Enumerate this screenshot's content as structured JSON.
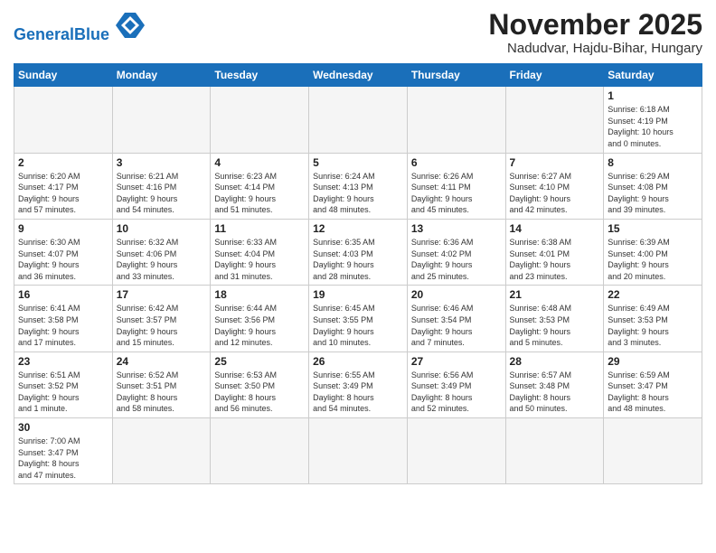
{
  "header": {
    "logo_general": "General",
    "logo_blue": "Blue",
    "title": "November 2025",
    "subtitle": "Nadudvar, Hajdu-Bihar, Hungary"
  },
  "weekdays": [
    "Sunday",
    "Monday",
    "Tuesday",
    "Wednesday",
    "Thursday",
    "Friday",
    "Saturday"
  ],
  "days": [
    {
      "num": "",
      "info": ""
    },
    {
      "num": "",
      "info": ""
    },
    {
      "num": "",
      "info": ""
    },
    {
      "num": "",
      "info": ""
    },
    {
      "num": "",
      "info": ""
    },
    {
      "num": "",
      "info": ""
    },
    {
      "num": "1",
      "info": "Sunrise: 6:18 AM\nSunset: 4:19 PM\nDaylight: 10 hours\nand 0 minutes."
    },
    {
      "num": "2",
      "info": "Sunrise: 6:20 AM\nSunset: 4:17 PM\nDaylight: 9 hours\nand 57 minutes."
    },
    {
      "num": "3",
      "info": "Sunrise: 6:21 AM\nSunset: 4:16 PM\nDaylight: 9 hours\nand 54 minutes."
    },
    {
      "num": "4",
      "info": "Sunrise: 6:23 AM\nSunset: 4:14 PM\nDaylight: 9 hours\nand 51 minutes."
    },
    {
      "num": "5",
      "info": "Sunrise: 6:24 AM\nSunset: 4:13 PM\nDaylight: 9 hours\nand 48 minutes."
    },
    {
      "num": "6",
      "info": "Sunrise: 6:26 AM\nSunset: 4:11 PM\nDaylight: 9 hours\nand 45 minutes."
    },
    {
      "num": "7",
      "info": "Sunrise: 6:27 AM\nSunset: 4:10 PM\nDaylight: 9 hours\nand 42 minutes."
    },
    {
      "num": "8",
      "info": "Sunrise: 6:29 AM\nSunset: 4:08 PM\nDaylight: 9 hours\nand 39 minutes."
    },
    {
      "num": "9",
      "info": "Sunrise: 6:30 AM\nSunset: 4:07 PM\nDaylight: 9 hours\nand 36 minutes."
    },
    {
      "num": "10",
      "info": "Sunrise: 6:32 AM\nSunset: 4:06 PM\nDaylight: 9 hours\nand 33 minutes."
    },
    {
      "num": "11",
      "info": "Sunrise: 6:33 AM\nSunset: 4:04 PM\nDaylight: 9 hours\nand 31 minutes."
    },
    {
      "num": "12",
      "info": "Sunrise: 6:35 AM\nSunset: 4:03 PM\nDaylight: 9 hours\nand 28 minutes."
    },
    {
      "num": "13",
      "info": "Sunrise: 6:36 AM\nSunset: 4:02 PM\nDaylight: 9 hours\nand 25 minutes."
    },
    {
      "num": "14",
      "info": "Sunrise: 6:38 AM\nSunset: 4:01 PM\nDaylight: 9 hours\nand 23 minutes."
    },
    {
      "num": "15",
      "info": "Sunrise: 6:39 AM\nSunset: 4:00 PM\nDaylight: 9 hours\nand 20 minutes."
    },
    {
      "num": "16",
      "info": "Sunrise: 6:41 AM\nSunset: 3:58 PM\nDaylight: 9 hours\nand 17 minutes."
    },
    {
      "num": "17",
      "info": "Sunrise: 6:42 AM\nSunset: 3:57 PM\nDaylight: 9 hours\nand 15 minutes."
    },
    {
      "num": "18",
      "info": "Sunrise: 6:44 AM\nSunset: 3:56 PM\nDaylight: 9 hours\nand 12 minutes."
    },
    {
      "num": "19",
      "info": "Sunrise: 6:45 AM\nSunset: 3:55 PM\nDaylight: 9 hours\nand 10 minutes."
    },
    {
      "num": "20",
      "info": "Sunrise: 6:46 AM\nSunset: 3:54 PM\nDaylight: 9 hours\nand 7 minutes."
    },
    {
      "num": "21",
      "info": "Sunrise: 6:48 AM\nSunset: 3:53 PM\nDaylight: 9 hours\nand 5 minutes."
    },
    {
      "num": "22",
      "info": "Sunrise: 6:49 AM\nSunset: 3:53 PM\nDaylight: 9 hours\nand 3 minutes."
    },
    {
      "num": "23",
      "info": "Sunrise: 6:51 AM\nSunset: 3:52 PM\nDaylight: 9 hours\nand 1 minute."
    },
    {
      "num": "24",
      "info": "Sunrise: 6:52 AM\nSunset: 3:51 PM\nDaylight: 8 hours\nand 58 minutes."
    },
    {
      "num": "25",
      "info": "Sunrise: 6:53 AM\nSunset: 3:50 PM\nDaylight: 8 hours\nand 56 minutes."
    },
    {
      "num": "26",
      "info": "Sunrise: 6:55 AM\nSunset: 3:49 PM\nDaylight: 8 hours\nand 54 minutes."
    },
    {
      "num": "27",
      "info": "Sunrise: 6:56 AM\nSunset: 3:49 PM\nDaylight: 8 hours\nand 52 minutes."
    },
    {
      "num": "28",
      "info": "Sunrise: 6:57 AM\nSunset: 3:48 PM\nDaylight: 8 hours\nand 50 minutes."
    },
    {
      "num": "29",
      "info": "Sunrise: 6:59 AM\nSunset: 3:47 PM\nDaylight: 8 hours\nand 48 minutes."
    },
    {
      "num": "30",
      "info": "Sunrise: 7:00 AM\nSunset: 3:47 PM\nDaylight: 8 hours\nand 47 minutes."
    },
    {
      "num": "",
      "info": ""
    },
    {
      "num": "",
      "info": ""
    },
    {
      "num": "",
      "info": ""
    },
    {
      "num": "",
      "info": ""
    },
    {
      "num": "",
      "info": ""
    }
  ]
}
